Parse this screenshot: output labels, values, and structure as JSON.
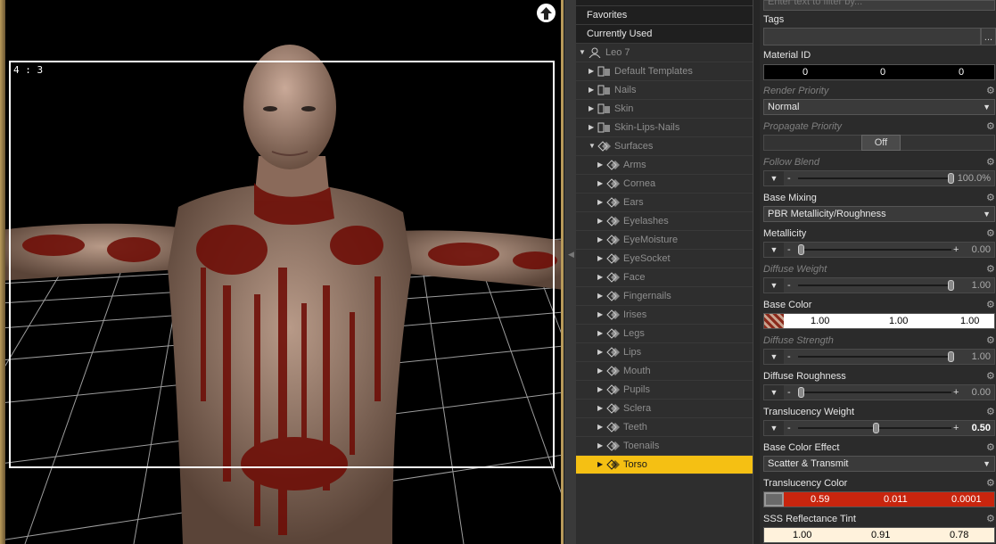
{
  "viewport": {
    "aspect_label": "4 : 3"
  },
  "tree": {
    "favorites": "Favorites",
    "currently_used": "Currently Used",
    "root": "Leo 7",
    "groups": [
      "Default Templates",
      "Nails",
      "Skin",
      "Skin-Lips-Nails"
    ],
    "surfaces_label": "Surfaces",
    "surfaces": [
      "Arms",
      "Cornea",
      "Ears",
      "Eyelashes",
      "EyeMoisture",
      "EyeSocket",
      "Face",
      "Fingernails",
      "Irises",
      "Legs",
      "Lips",
      "Mouth",
      "Pupils",
      "Sclera",
      "Teeth",
      "Toenails",
      "Torso"
    ],
    "selected": "Torso",
    "selected_color": "#f5c013"
  },
  "props": {
    "filter_placeholder": "Enter text to filter by...",
    "tags": {
      "label": "Tags",
      "button": "..."
    },
    "material_id": {
      "label": "Material ID",
      "values": [
        "0",
        "0",
        "0"
      ]
    },
    "render_priority": {
      "label": "Render Priority",
      "value": "Normal"
    },
    "propagate_priority": {
      "label": "Propagate Priority",
      "value": "Off"
    },
    "follow_blend": {
      "label": "Follow Blend",
      "value": "100.0%",
      "fraction": 1.0
    },
    "base_mixing": {
      "label": "Base Mixing",
      "value": "PBR Metallicity/Roughness"
    },
    "metallicity": {
      "label": "Metallicity",
      "value": "0.00",
      "fraction": 0.0
    },
    "diffuse_weight": {
      "label": "Diffuse Weight",
      "value": "1.00",
      "fraction": 1.0
    },
    "base_color": {
      "label": "Base Color",
      "values": [
        "1.00",
        "1.00",
        "1.00"
      ],
      "bg": "#ffffff"
    },
    "diffuse_strength": {
      "label": "Diffuse Strength",
      "value": "1.00",
      "fraction": 1.0
    },
    "diffuse_roughness": {
      "label": "Diffuse Roughness",
      "value": "0.00",
      "fraction": 0.0
    },
    "translucency_weight": {
      "label": "Translucency Weight",
      "value": "0.50",
      "fraction": 0.5
    },
    "base_color_effect": {
      "label": "Base Color Effect",
      "value": "Scatter & Transmit"
    },
    "translucency_color": {
      "label": "Translucency Color",
      "values": [
        "0.59",
        "0.011",
        "0.0001"
      ],
      "bg": "#c8250e"
    },
    "sss_reflectance_tint": {
      "label": "SSS Reflectance Tint",
      "values": [
        "1.00",
        "0.91",
        "0.78"
      ],
      "bg": "#fff2dc"
    }
  }
}
